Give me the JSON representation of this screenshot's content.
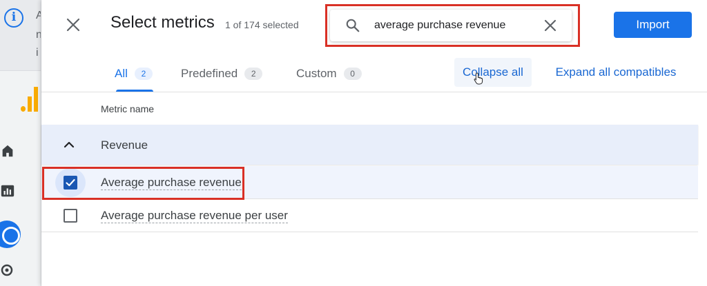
{
  "background": {
    "banner_lines": [
      "A",
      "n",
      "i"
    ]
  },
  "dialog": {
    "title": "Select metrics",
    "selection_count": "1 of 174 selected",
    "search": {
      "value": "average purchase revenue",
      "icon": "search-icon"
    },
    "import_label": "Import",
    "tabs": [
      {
        "label": "All",
        "count": "2",
        "active": true
      },
      {
        "label": "Predefined",
        "count": "2",
        "active": false
      },
      {
        "label": "Custom",
        "count": "0",
        "active": false
      }
    ],
    "collapse_all_label": "Collapse all",
    "expand_all_label": "Expand all compatibles",
    "column_header": "Metric name",
    "groups": [
      {
        "label": "Revenue",
        "expanded": true,
        "metrics": [
          {
            "label": "Average purchase revenue",
            "checked": true
          },
          {
            "label": "Average purchase revenue per user",
            "checked": false
          }
        ]
      }
    ]
  },
  "colors": {
    "accent": "#1a73e8",
    "highlight_box": "#d93025",
    "group_row_bg": "#e8eefa"
  }
}
